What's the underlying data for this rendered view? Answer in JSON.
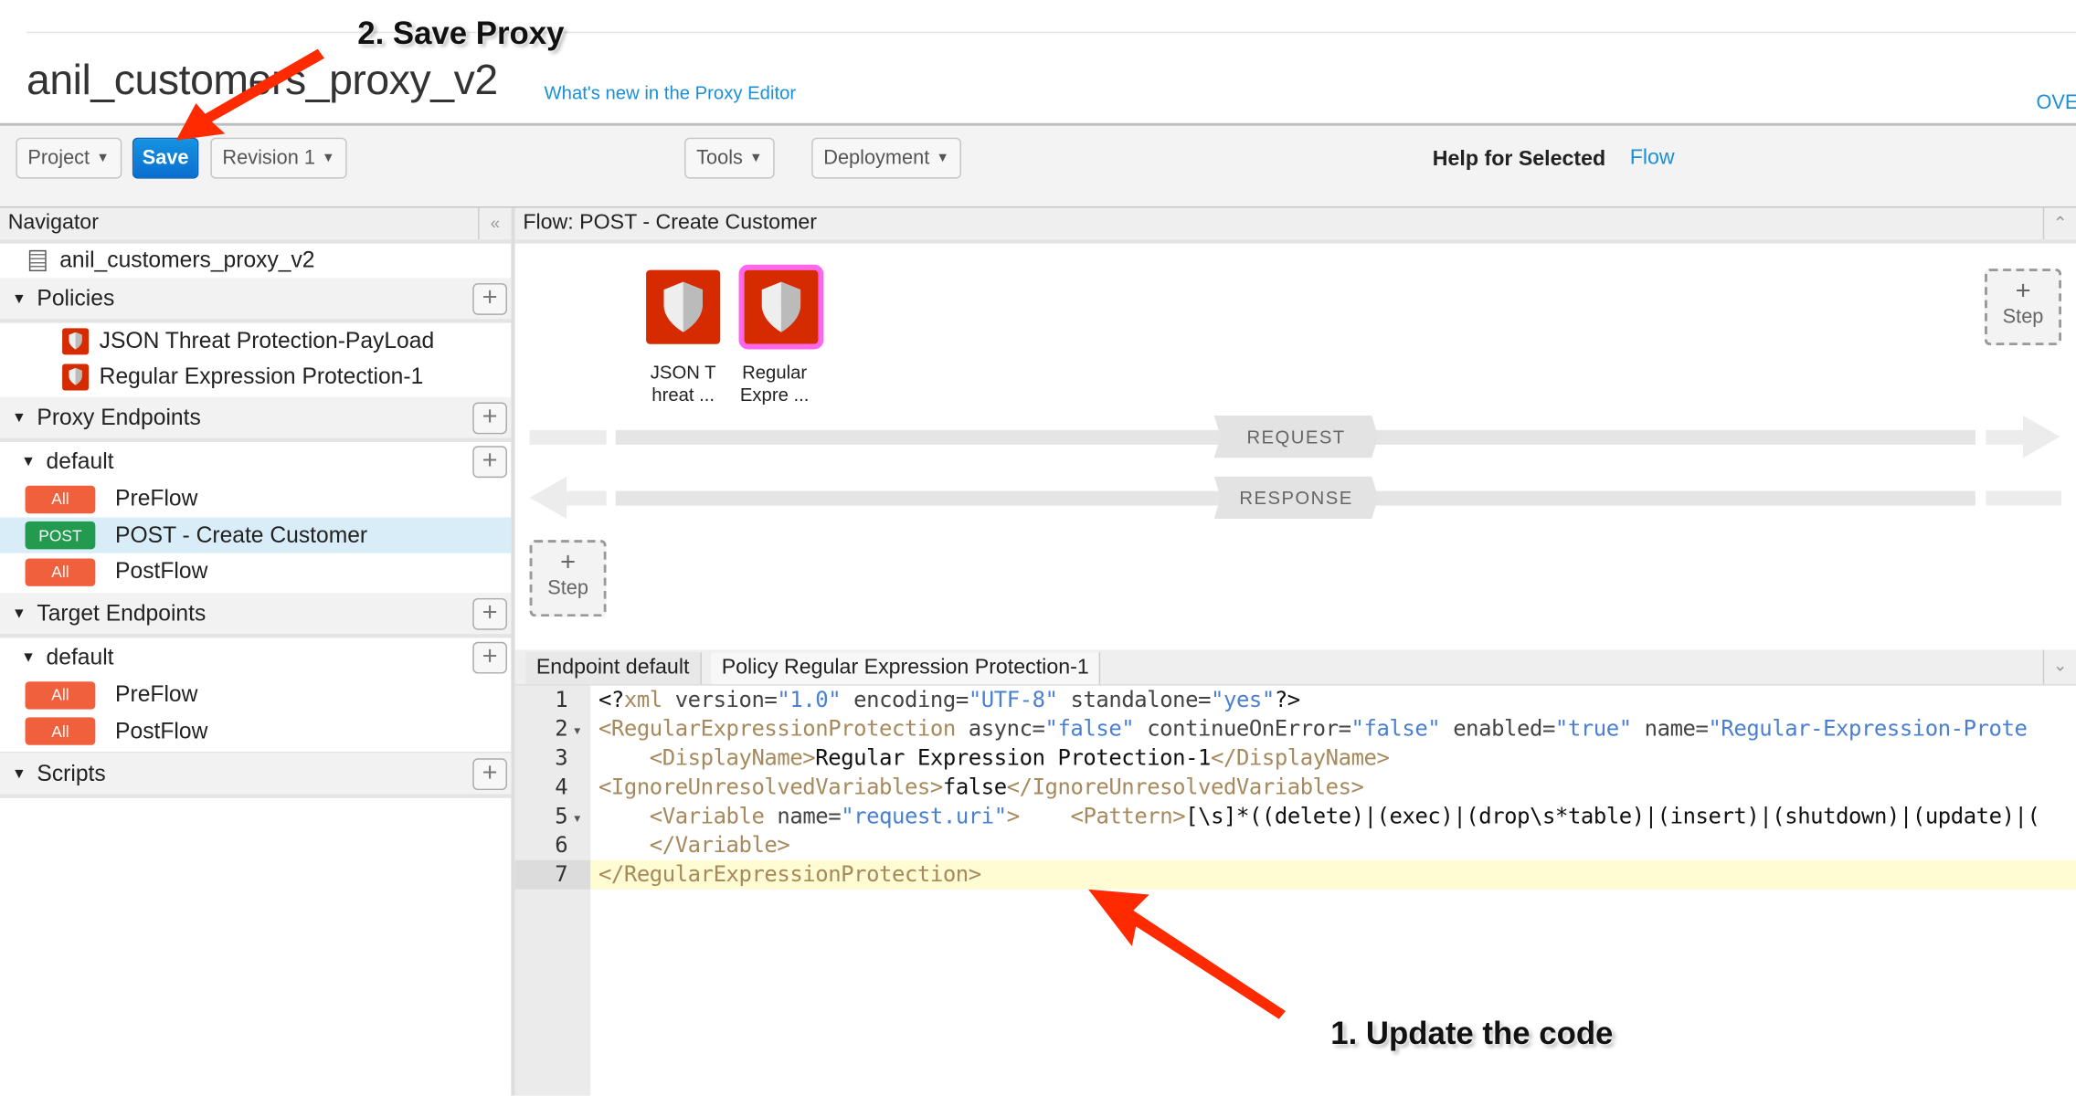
{
  "header": {
    "title": "anil_customers_proxy_v2",
    "whats_new_link": "What's new in the Proxy Editor",
    "overview_link": "OVE"
  },
  "toolbar": {
    "project": "Project",
    "save": "Save",
    "revision": "Revision 1",
    "tools": "Tools",
    "deployment": "Deployment",
    "help_label": "Help for Selected",
    "help_link": "Flow"
  },
  "navigator": {
    "title": "Navigator",
    "collapse": "«",
    "project_name": "anil_customers_proxy_v2",
    "policies_label": "Policies",
    "policies": [
      "JSON Threat Protection-PayLoad",
      "Regular Expression Protection-1"
    ],
    "proxy_endpoints_label": "Proxy Endpoints",
    "proxy_default": "default",
    "proxy_flows": [
      {
        "badge": "All",
        "badge_color": "#f0603c",
        "label": "PreFlow"
      },
      {
        "badge": "POST",
        "badge_color": "#229a4f",
        "label": "POST - Create Customer",
        "selected": true
      },
      {
        "badge": "All",
        "badge_color": "#f0603c",
        "label": "PostFlow"
      }
    ],
    "target_endpoints_label": "Target Endpoints",
    "target_default": "default",
    "target_flows": [
      {
        "badge": "All",
        "badge_color": "#f0603c",
        "label": "PreFlow"
      },
      {
        "badge": "All",
        "badge_color": "#f0603c",
        "label": "PostFlow"
      }
    ],
    "scripts_label": "Scripts",
    "selected_color": "#d9edf8"
  },
  "flow": {
    "title": "Flow: POST - Create Customer",
    "policies": [
      {
        "label_line1": "JSON T",
        "label_line2": "hreat ..."
      },
      {
        "label_line1": "Regular",
        "label_line2": "Expre ...",
        "selected": true
      }
    ],
    "request_label": "REQUEST",
    "response_label": "RESPONSE",
    "step_plus": "+",
    "step_label": "Step"
  },
  "editor": {
    "tabs": [
      "Endpoint default",
      "Policy Regular Expression Protection-1"
    ],
    "active_line": 7,
    "lines": [
      [
        [
          "text",
          "<?"
        ],
        [
          "tag",
          "xml"
        ],
        [
          "attr",
          " version="
        ],
        [
          "val",
          "\"1.0\""
        ],
        [
          "attr",
          " encoding="
        ],
        [
          "val",
          "\"UTF-8\""
        ],
        [
          "attr",
          " standalone="
        ],
        [
          "val",
          "\"yes\""
        ],
        [
          "text",
          "?>"
        ]
      ],
      [
        [
          "tag",
          "<RegularExpressionProtection"
        ],
        [
          "attr",
          " async="
        ],
        [
          "val",
          "\"false\""
        ],
        [
          "attr",
          " continueOnError="
        ],
        [
          "val",
          "\"false\""
        ],
        [
          "attr",
          " enabled="
        ],
        [
          "val",
          "\"true\""
        ],
        [
          "attr",
          " name="
        ],
        [
          "val",
          "\"Regular-Expression-Prote"
        ]
      ],
      [
        [
          "text",
          "    "
        ],
        [
          "tag",
          "<DisplayName>"
        ],
        [
          "text",
          "Regular Expression Protection-1"
        ],
        [
          "tag",
          "</DisplayName>"
        ]
      ],
      [
        [
          "tag",
          "<IgnoreUnresolvedVariables>"
        ],
        [
          "text",
          "false"
        ],
        [
          "tag",
          "</IgnoreUnresolvedVariables>"
        ]
      ],
      [
        [
          "text",
          "    "
        ],
        [
          "tag",
          "<Variable"
        ],
        [
          "attr",
          " name="
        ],
        [
          "val",
          "\"request.uri\""
        ],
        [
          "tag",
          ">"
        ],
        [
          "text",
          "    "
        ],
        [
          "tag",
          "<Pattern>"
        ],
        [
          "text",
          "[\\s]*((delete)|(exec)|(drop\\s*table)|(insert)|(shutdown)|(update)|("
        ]
      ],
      [
        [
          "text",
          "    "
        ],
        [
          "tag",
          "</Variable>"
        ]
      ],
      [
        [
          "tag",
          "</RegularExpressionProtection>"
        ]
      ]
    ],
    "foldable_lines": [
      2,
      5
    ]
  },
  "annotations": {
    "save_note": "2. Save Proxy",
    "update_note": "1. Update the code",
    "arrow_color": "#ff2a00"
  }
}
